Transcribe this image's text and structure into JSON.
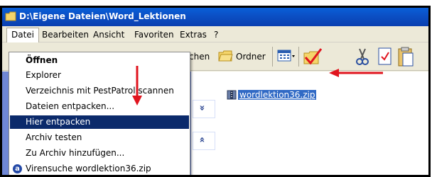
{
  "window": {
    "title": "D:\\Eigene Dateien\\Word_Lektionen"
  },
  "menubar": {
    "items": [
      "Datei",
      "Bearbeiten",
      "Ansicht",
      "Favoriten",
      "Extras",
      "?"
    ]
  },
  "toolbar": {
    "search_partial": "chen",
    "folders_label": "Ordner"
  },
  "context_menu": {
    "items": [
      {
        "label": "Öffnen"
      },
      {
        "label": "Explorer"
      },
      {
        "label": "Verzeichnis mit PestPatrol scannen"
      },
      {
        "label": "Dateien entpacken..."
      },
      {
        "label": "Hier entpacken"
      },
      {
        "label": "Archiv testen"
      },
      {
        "label": "Zu Archiv hinzufügen..."
      },
      {
        "label": "Virensuche wordlektion36.zip"
      }
    ]
  },
  "left_panel": {
    "chevron_down": "»",
    "chevron_up": "«"
  },
  "files": [
    {
      "name": "wordlektion36.zip"
    }
  ],
  "colors": {
    "titlebar": "#0b4fc4",
    "selection": "#316ac5",
    "menu_highlight": "#0b2a6b",
    "panel": "#6f87d6",
    "arrow": "#e0141e"
  }
}
